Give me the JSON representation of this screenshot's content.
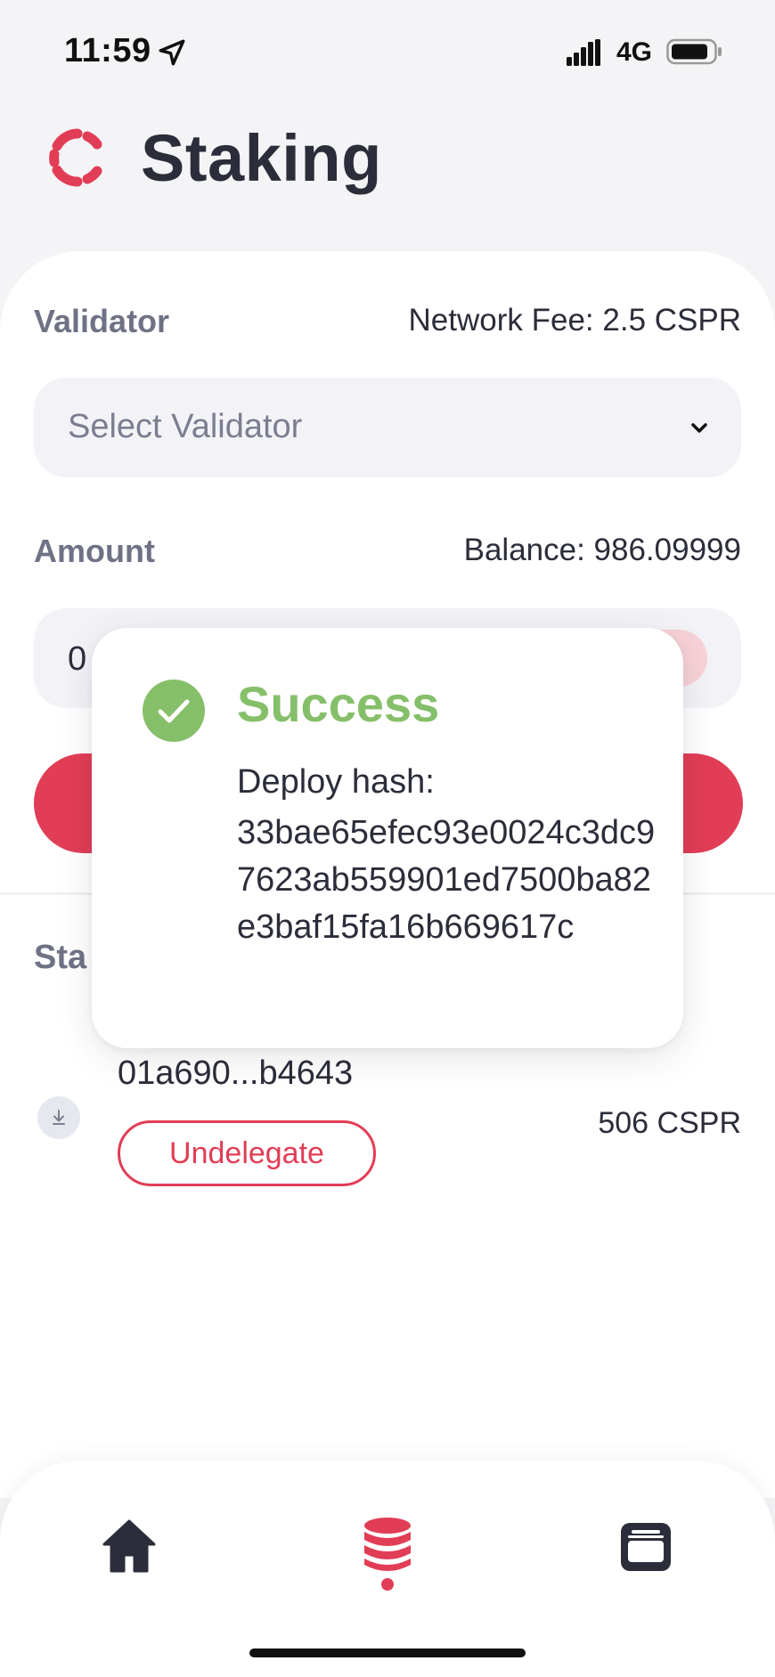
{
  "status_bar": {
    "time": "11:59",
    "network": "4G",
    "icons": [
      "location-arrow-icon",
      "signal-icon",
      "battery-icon"
    ]
  },
  "header": {
    "title": "Staking",
    "logo": "casper-logo"
  },
  "form": {
    "validator_label": "Validator",
    "network_fee": "Network Fee: 2.5 CSPR",
    "validator_placeholder": "Select Validator",
    "amount_label": "Amount",
    "balance": "Balance: 986.09999",
    "amount_value": "0"
  },
  "stakes_section": {
    "title": "Sta",
    "items": [
      {
        "validator": "01a690...b4643",
        "action_label": "Undelegate",
        "amount": "506 CSPR"
      }
    ]
  },
  "modal": {
    "title": "Success",
    "label": "Deploy hash:",
    "hash": "33bae65efec93e0024c3dc97623ab559901ed7500ba82e3baf15fa16b669617c"
  },
  "bottom_nav": {
    "items": [
      "home-icon",
      "staking-icon",
      "wallet-icon"
    ],
    "active": "staking-icon"
  },
  "colors": {
    "accent": "#e23d56",
    "success": "#86bf6a",
    "text": "#2b2d3a",
    "muted": "#6f7285"
  }
}
